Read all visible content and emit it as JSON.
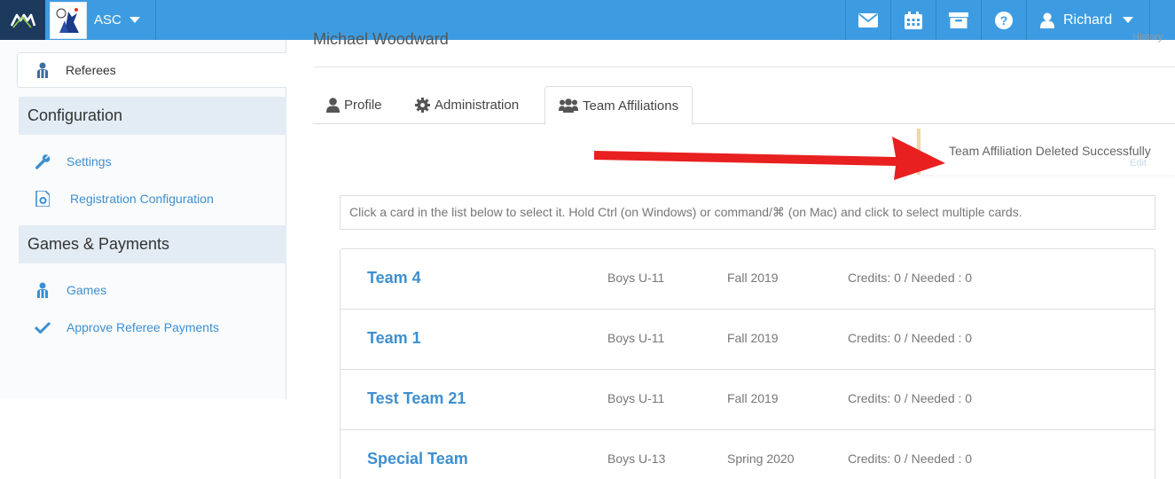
{
  "header": {
    "org_name": "ASC",
    "user_name": "Richard",
    "icons": [
      "envelope-icon",
      "calendar-icon",
      "archive-icon",
      "question-icon",
      "user-icon"
    ]
  },
  "sidebar": {
    "active_item": "Referees",
    "sections": [
      {
        "title": "Configuration",
        "items": [
          "Settings",
          "Registration Configuration"
        ]
      },
      {
        "title": "Games & Payments",
        "items": [
          "Games",
          "Approve Referee Payments"
        ]
      }
    ]
  },
  "page": {
    "person_name": "Michael Woodward",
    "history_link": "History"
  },
  "tabs": [
    "Profile",
    "Administration",
    "Team Affiliations"
  ],
  "active_tab": "Team Affiliations",
  "toast": {
    "message": "Team Affiliation Deleted Successfully",
    "edit_label": "Edit"
  },
  "hint": "Click a card in the list below to select it. Hold Ctrl (on Windows) or command/⌘ (on Mac) and click to select multiple cards.",
  "teams": [
    {
      "name": "Team 4",
      "division": "Boys U-11",
      "season": "Fall 2019",
      "credits": "Credits: 0 / Needed : 0"
    },
    {
      "name": "Team 1",
      "division": "Boys U-11",
      "season": "Fall 2019",
      "credits": "Credits: 0 / Needed : 0"
    },
    {
      "name": "Test Team 21",
      "division": "Boys U-11",
      "season": "Fall 2019",
      "credits": "Credits: 0 / Needed : 0"
    },
    {
      "name": "Special Team",
      "division": "Boys U-13",
      "season": "Spring 2020",
      "credits": "Credits: 0 / Needed : 0"
    }
  ],
  "colors": {
    "topbar": "#3d9ce1",
    "link": "#3d8fd1",
    "arrow": "#e8201f"
  }
}
